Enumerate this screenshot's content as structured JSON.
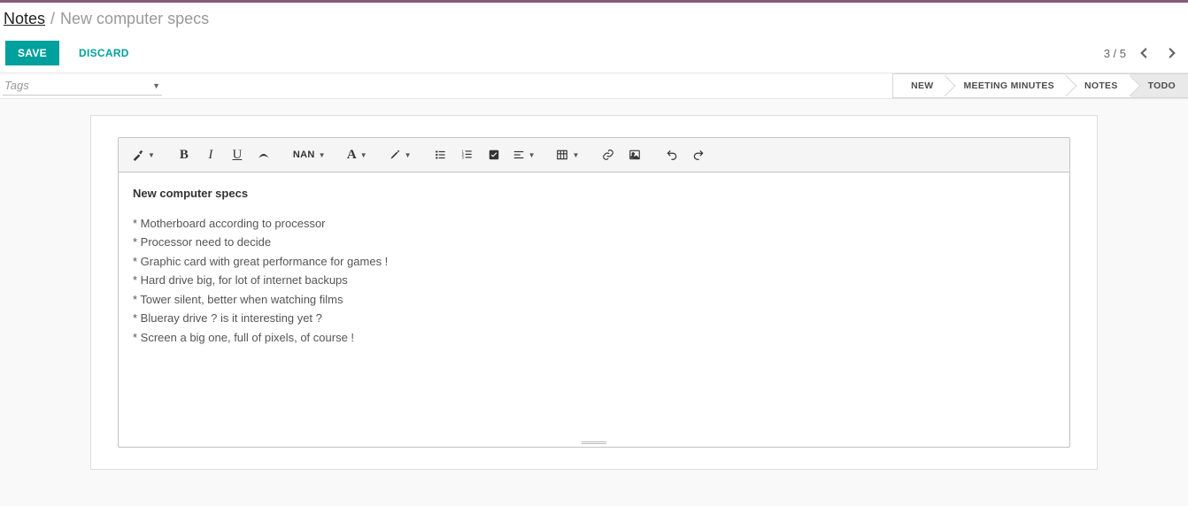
{
  "breadcrumb": {
    "root": "Notes",
    "separator": "/",
    "current": "New computer specs"
  },
  "actions": {
    "save": "SAVE",
    "discard": "DISCARD"
  },
  "pager": {
    "text": "3 / 5"
  },
  "tags": {
    "placeholder": "Tags"
  },
  "stages": {
    "0": "NEW",
    "1": "MEETING MINUTES",
    "2": "NOTES",
    "3": "TODO",
    "active_index": 3
  },
  "toolbar": {
    "font_size_label": "NAN"
  },
  "note": {
    "title": "New computer specs",
    "lines": {
      "0": "* Motherboard according to processor",
      "1": "* Processor need to decide",
      "2": "* Graphic card with great performance for games !",
      "3": "* Hard drive big, for lot of internet backups",
      "4": "* Tower silent, better when watching films",
      "5": "* Blueray drive ? is it interesting yet ?",
      "6": "* Screen a big one, full of pixels, of course !"
    }
  }
}
